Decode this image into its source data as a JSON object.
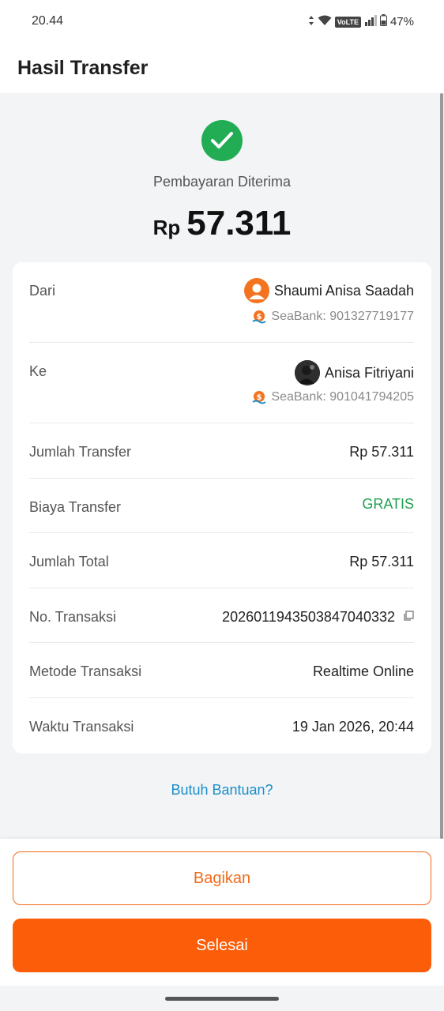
{
  "status_bar": {
    "time": "20.44",
    "network": "VoLTE",
    "battery": "47%"
  },
  "header": {
    "title": "Hasil Transfer"
  },
  "result": {
    "status": "Pembayaran Diterima",
    "currency": "Rp",
    "amount": "57.311",
    "status_color": "#22ad55"
  },
  "details": {
    "from": {
      "label": "Dari",
      "name": "Shaumi Anisa Saadah",
      "bank": "SeaBank: 901327719177"
    },
    "to": {
      "label": "Ke",
      "name": "Anisa Fitriyani",
      "bank": "SeaBank: 901041794205"
    },
    "rows": [
      {
        "label": "Jumlah Transfer",
        "value": "Rp 57.311"
      },
      {
        "label": "Biaya Transfer",
        "value": "GRATIS"
      },
      {
        "label": "Jumlah Total",
        "value": "Rp 57.311"
      },
      {
        "label": "No. Transaksi",
        "value": "202601194350384704033​2"
      },
      {
        "label": "Metode Transaksi",
        "value": "Realtime Online"
      },
      {
        "label": "Waktu Transaksi",
        "value": "19 Jan 2026, 20:44"
      }
    ]
  },
  "help": {
    "label": "Butuh Bantuan?"
  },
  "actions": {
    "share_label": "Bagikan",
    "done_label": "Selesai",
    "accent_color": "#fb5d08"
  },
  "icons": [
    "check-icon",
    "wifi-icon",
    "signal-icon",
    "battery-icon",
    "copy-icon",
    "seabank-logo-icon",
    "avatar-icon"
  ]
}
